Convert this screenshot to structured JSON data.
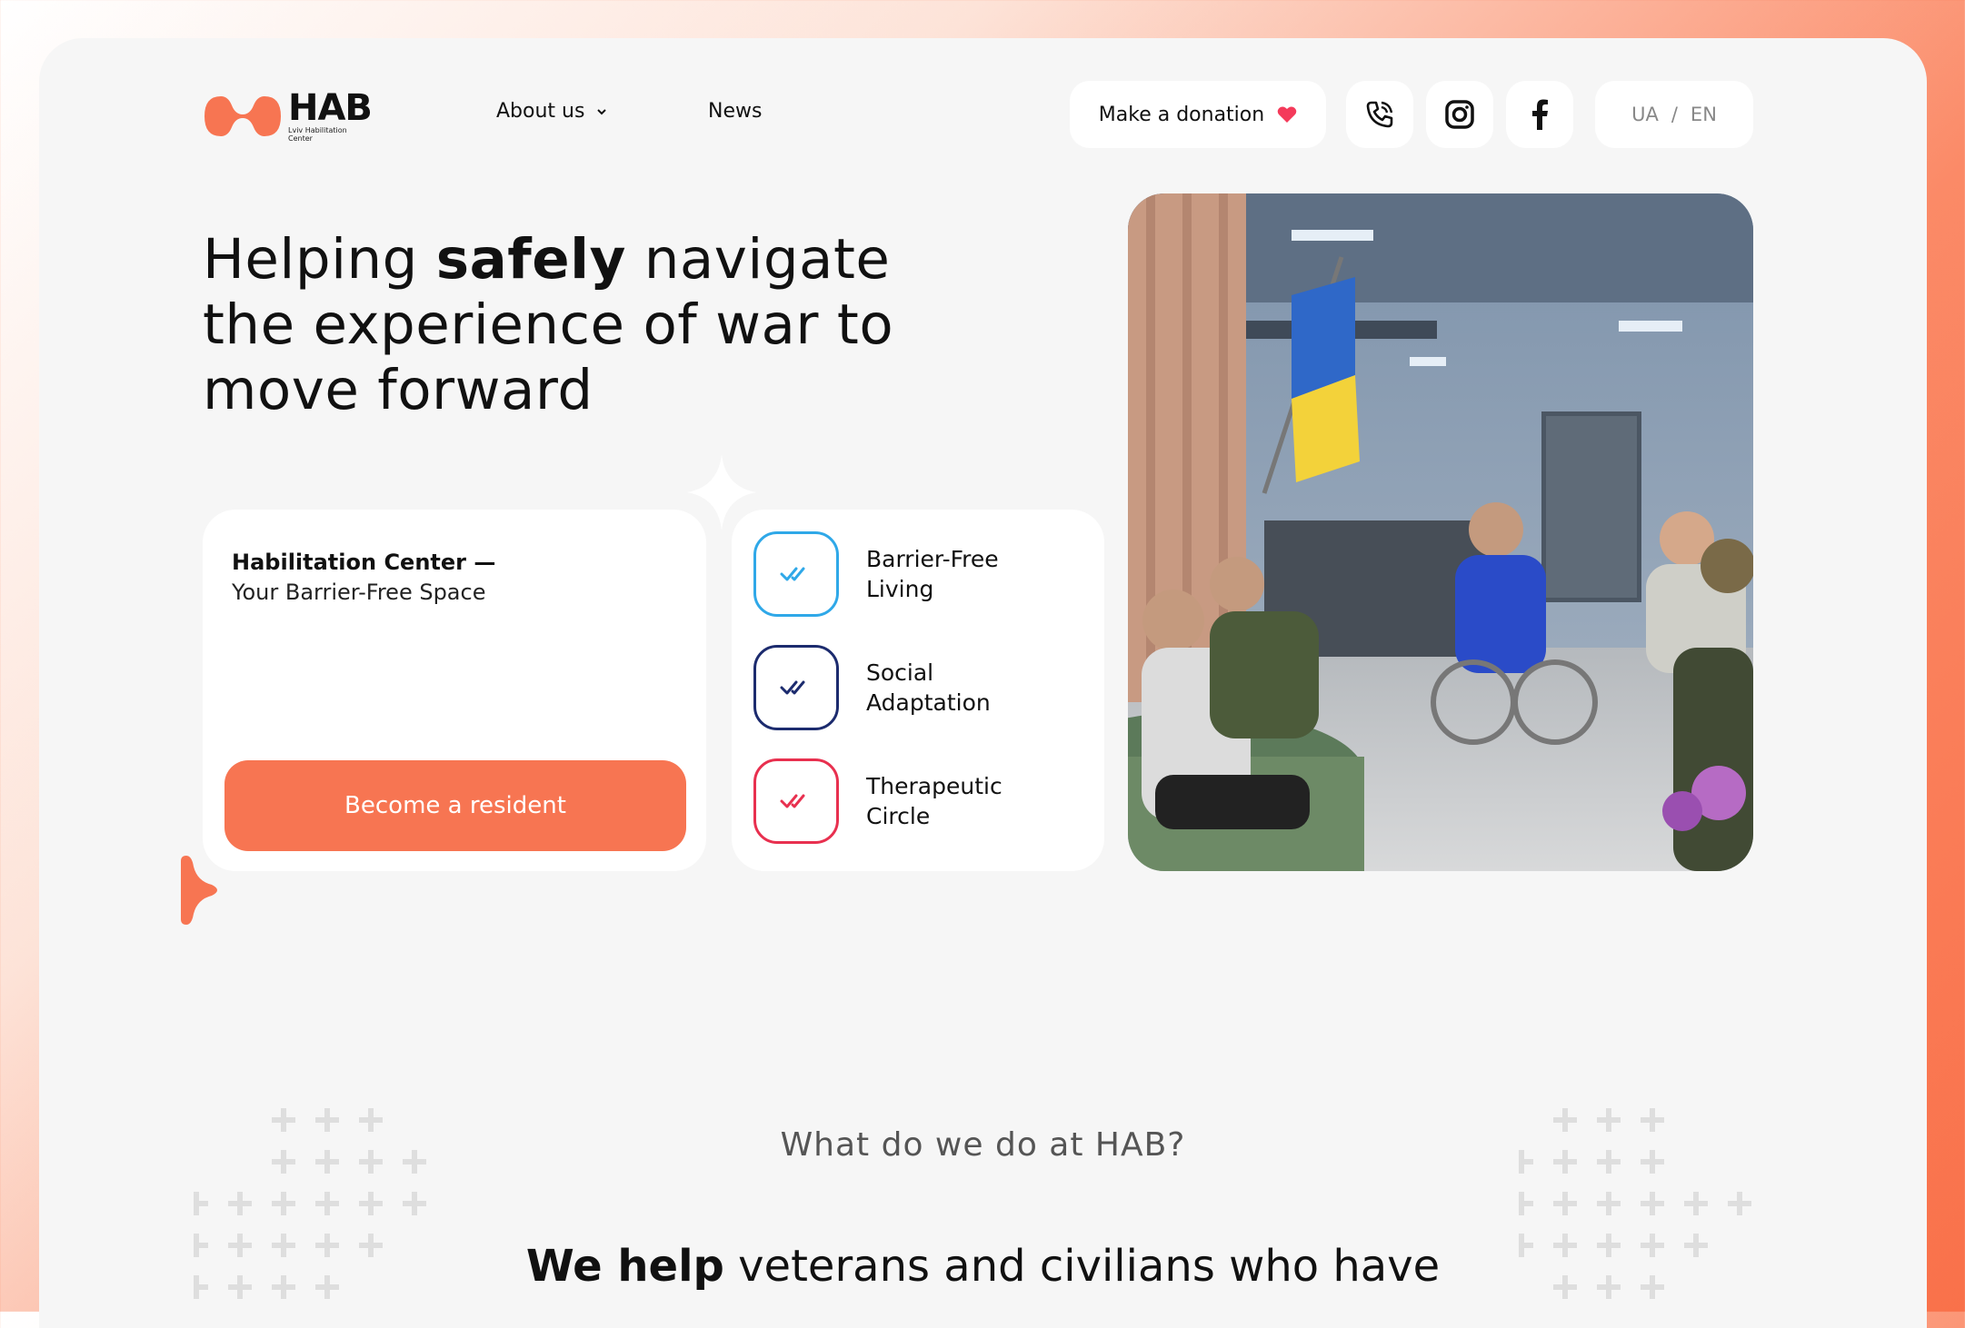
{
  "brand": {
    "name": "HAB",
    "subtitle": "Lviv Habilitation Center",
    "accent": "#f77552"
  },
  "nav": {
    "about": "About us",
    "news": "News"
  },
  "header": {
    "donate_label": "Make a donation",
    "lang_ua": "UA",
    "lang_sep": "/",
    "lang_en": "EN"
  },
  "icons": {
    "donate": "heart-icon",
    "phone": "phone-icon",
    "instagram": "instagram-icon",
    "facebook": "facebook-icon"
  },
  "hero": {
    "headline_pre": "Helping ",
    "headline_bold": "safely",
    "headline_post": " navigate the experience of war to move forward",
    "card_title": "Habilitation Center —",
    "card_subtitle": "Your Barrier-Free Space",
    "cta_label": "Become a resident",
    "features": [
      {
        "label": "Barrier-Free Living",
        "color": "#2fa8e8"
      },
      {
        "label": "Social Adaptation",
        "color": "#1c2b6e"
      },
      {
        "label": "Therapeutic Circle",
        "color": "#e8304f"
      }
    ]
  },
  "section": {
    "question": "What do we do at HAB?",
    "help_bold": "We help",
    "help_rest": " veterans and civilians who have"
  }
}
